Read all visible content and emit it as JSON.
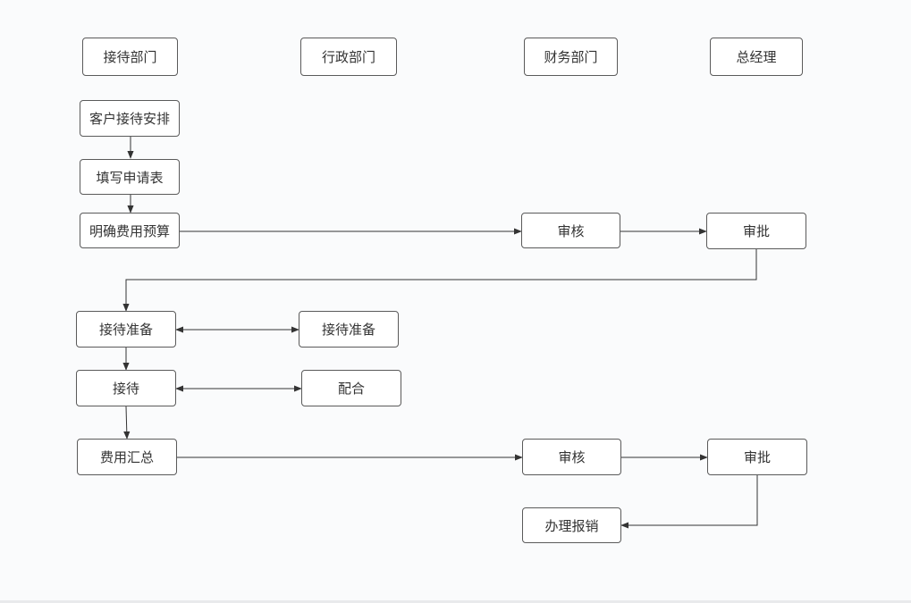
{
  "diagram": {
    "type": "flowchart",
    "lanes": [
      {
        "id": "lane1",
        "label": "接待部门"
      },
      {
        "id": "lane2",
        "label": "行政部门"
      },
      {
        "id": "lane3",
        "label": "财务部门"
      },
      {
        "id": "lane4",
        "label": "总经理"
      }
    ],
    "nodes": [
      {
        "id": "n1",
        "label": "客户接待安排"
      },
      {
        "id": "n2",
        "label": "填写申请表"
      },
      {
        "id": "n3",
        "label": "明确费用预算"
      },
      {
        "id": "n4",
        "label": "审核"
      },
      {
        "id": "n5",
        "label": "审批"
      },
      {
        "id": "n6",
        "label": "接待准备"
      },
      {
        "id": "n7",
        "label": "接待准备"
      },
      {
        "id": "n8",
        "label": "接待"
      },
      {
        "id": "n9",
        "label": "配合"
      },
      {
        "id": "n10",
        "label": "费用汇总"
      },
      {
        "id": "n11",
        "label": "审核"
      },
      {
        "id": "n12",
        "label": "审批"
      },
      {
        "id": "n13",
        "label": "办理报销"
      }
    ],
    "edges": [
      {
        "from": "n1",
        "to": "n2",
        "direction": "forward"
      },
      {
        "from": "n2",
        "to": "n3",
        "direction": "forward"
      },
      {
        "from": "n3",
        "to": "n4",
        "direction": "forward"
      },
      {
        "from": "n4",
        "to": "n5",
        "direction": "forward"
      },
      {
        "from": "n5",
        "to": "n6",
        "direction": "forward"
      },
      {
        "from": "n6",
        "to": "n7",
        "direction": "both"
      },
      {
        "from": "n6",
        "to": "n8",
        "direction": "forward"
      },
      {
        "from": "n8",
        "to": "n9",
        "direction": "both"
      },
      {
        "from": "n8",
        "to": "n10",
        "direction": "forward"
      },
      {
        "from": "n10",
        "to": "n11",
        "direction": "forward"
      },
      {
        "from": "n11",
        "to": "n12",
        "direction": "forward"
      },
      {
        "from": "n12",
        "to": "n13",
        "direction": "forward"
      }
    ]
  }
}
